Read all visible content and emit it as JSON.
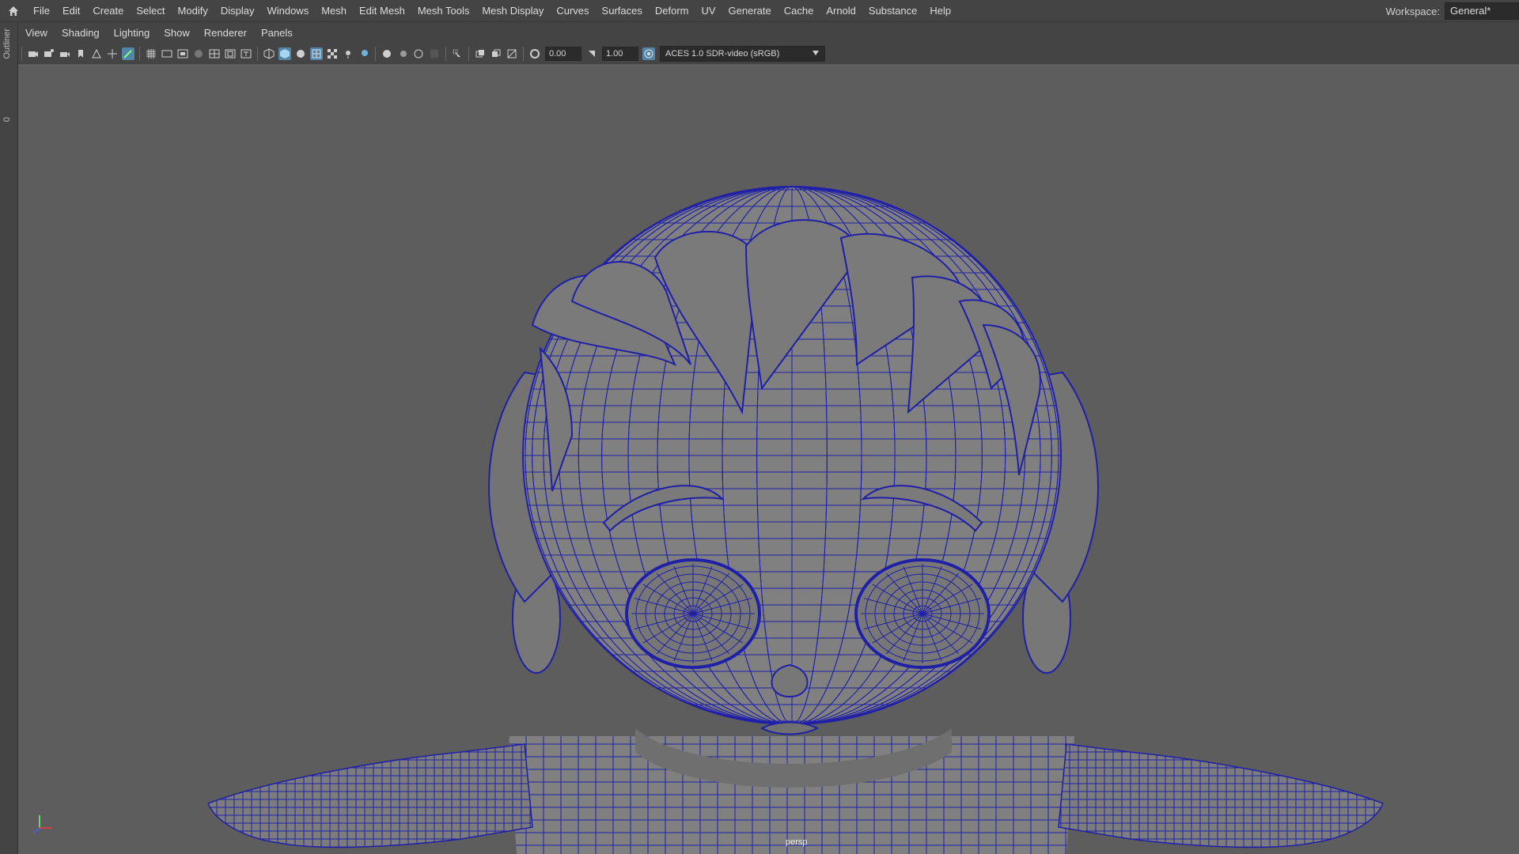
{
  "menubar": {
    "items": [
      "File",
      "Edit",
      "Create",
      "Select",
      "Modify",
      "Display",
      "Windows",
      "Mesh",
      "Edit Mesh",
      "Mesh Tools",
      "Mesh Display",
      "Curves",
      "Surfaces",
      "Deform",
      "UV",
      "Generate",
      "Cache",
      "Arnold",
      "Substance",
      "Help"
    ],
    "workspace_label": "Workspace:",
    "workspace_value": "General*"
  },
  "leftstrip": {
    "outliner": "Outliner",
    "num": "0"
  },
  "panel_menu": [
    "View",
    "Shading",
    "Lighting",
    "Show",
    "Renderer",
    "Panels"
  ],
  "toolbar": {
    "exposure": "0.00",
    "gamma": "1.00",
    "color_management": "ACES 1.0 SDR-video (sRGB)"
  },
  "viewport": {
    "camera": "persp",
    "wire_color": "#1f1fa8",
    "bg_color": "#5d5d5d"
  }
}
